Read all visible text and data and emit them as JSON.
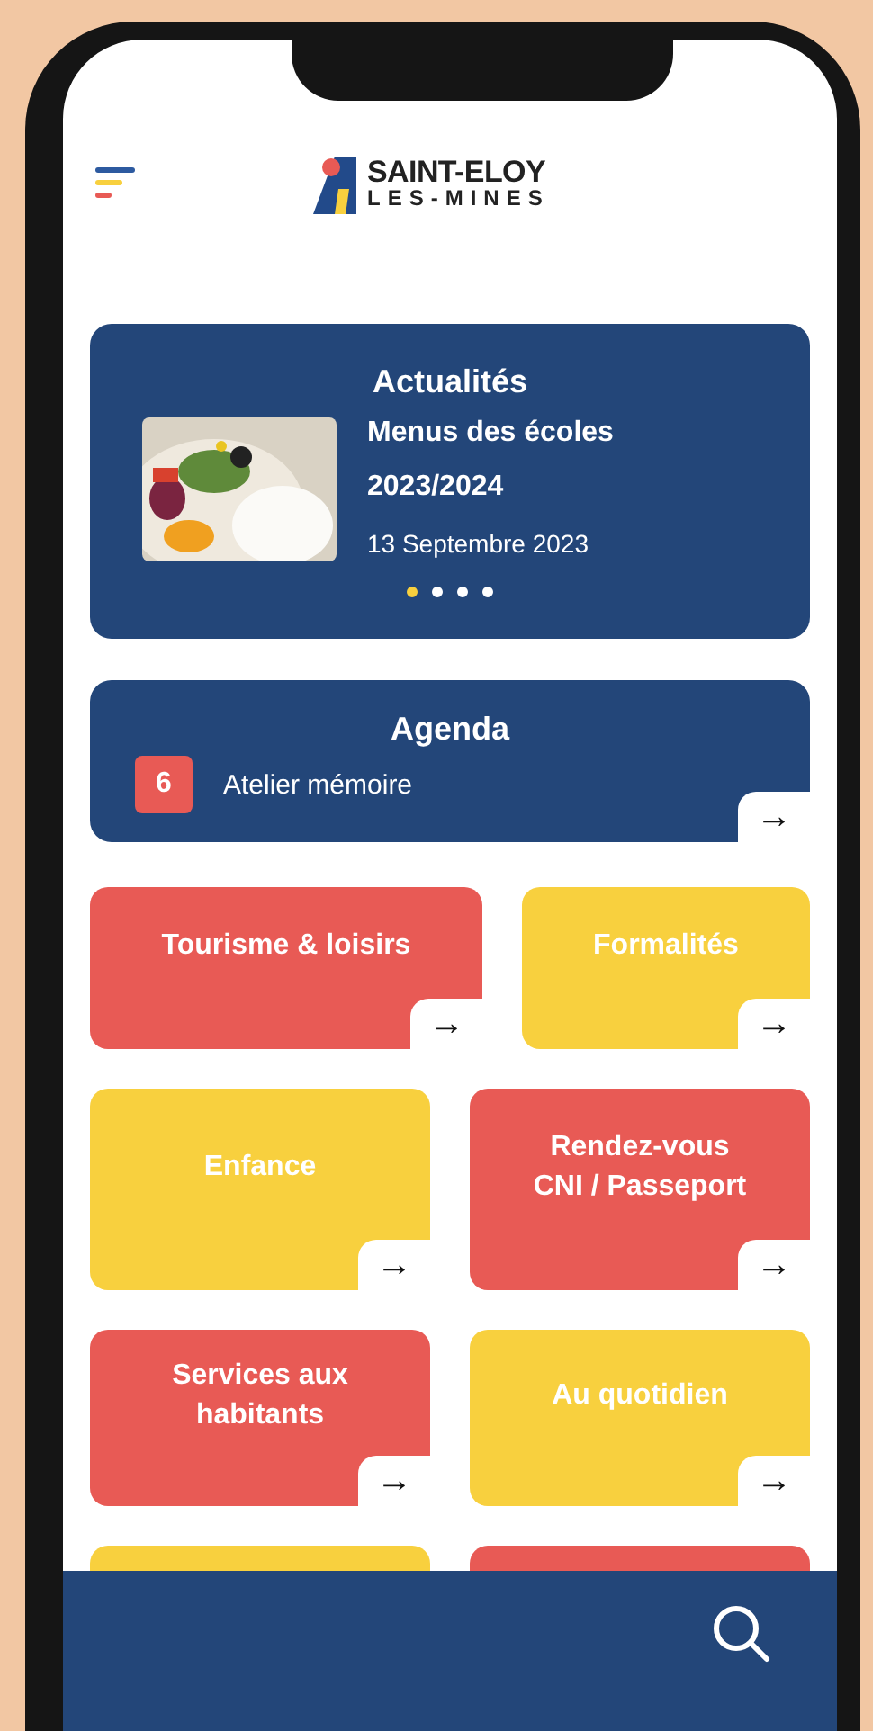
{
  "header": {
    "logo": {
      "line_1": "SAINT-ELOY",
      "line_2": "LES-MINES"
    }
  },
  "news": {
    "title": "Actualités",
    "item": {
      "kind": "picture",
      "headline": "Menus des écoles",
      "subtitle": "2023/2024",
      "date": "13 Septembre 2023"
    },
    "dots": [
      {
        "selected": true
      },
      {
        "selected": false
      },
      {
        "selected": false
      },
      {
        "selected": false
      }
    ]
  },
  "agenda": {
    "title": "Agenda",
    "event": {
      "day": "6",
      "name": "Atelier mémoire"
    },
    "arrow": "→"
  },
  "tile_rows": [
    {
      "kind": "wide-left",
      "tiles": [
        {
          "label": "Tourisme & loisirs",
          "color": "#e85a55",
          "arrow": "→"
        },
        {
          "label": "Formalités",
          "color": "#f8d03e",
          "arrow": "→"
        }
      ]
    },
    {
      "kind": "even",
      "tiles": [
        {
          "label": "Enfance",
          "color": "#f8d03e",
          "arrow": "→"
        },
        {
          "label": "Rendez-vous CNI / Passeport",
          "color": "#e85a55",
          "arrow": "→"
        }
      ]
    },
    {
      "kind": "even",
      "tiles": [
        {
          "label": "Services aux habitants",
          "color": "#e85a55",
          "arrow": "→"
        },
        {
          "label": "Au quotidien",
          "color": "#f8d03e",
          "arrow": "→"
        }
      ]
    },
    {
      "kind": "even",
      "tiles": [
        {
          "color": "#f8d03e"
        },
        {
          "color": "#e85a55"
        }
      ]
    }
  ]
}
